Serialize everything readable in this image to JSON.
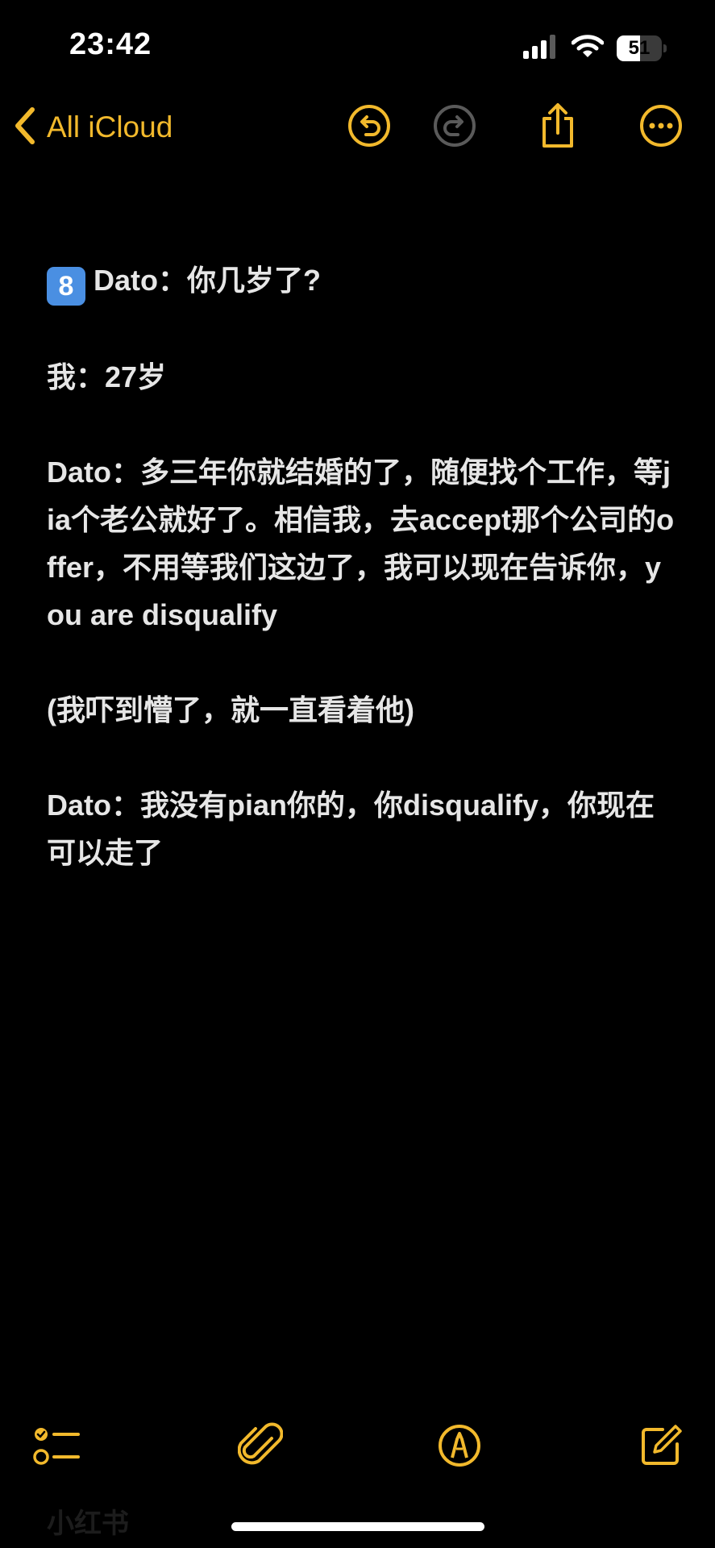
{
  "status": {
    "time": "23:42",
    "battery": "51",
    "battery_level": 0.51
  },
  "nav": {
    "back_label": "All iCloud",
    "icons": [
      "undo-icon",
      "redo-icon",
      "share-icon",
      "more-icon"
    ]
  },
  "note": {
    "badge": "8",
    "lines": [
      "Dato：你几岁了?",
      "我：27岁",
      "Dato：多三年你就结婚的了，随便找个工作，等jia个老公就好了。相信我，去accept那个公司的offer，不用等我们这边了，我可以现在告诉你，you are disqualify",
      "(我吓到懵了，就一直看着他)",
      "Dato：我没有pian你的，你disqualify，你现在可以走了"
    ]
  },
  "toolbar": {
    "icons": [
      "checklist-icon",
      "attachment-icon",
      "markup-icon",
      "compose-icon"
    ]
  },
  "ghost": {
    "text": "小红书"
  },
  "colors": {
    "accent": "#f2b92c",
    "disabled": "#5a5a5a",
    "background": "#000000",
    "text": "#e6e6e6"
  }
}
